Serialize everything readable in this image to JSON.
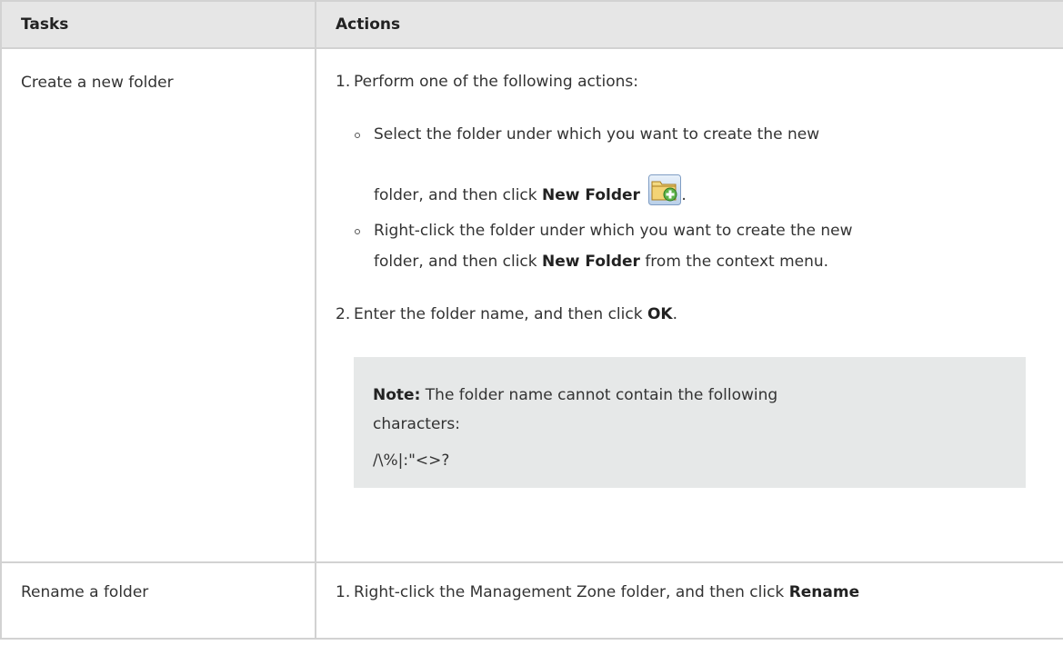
{
  "table": {
    "headers": {
      "tasks": "Tasks",
      "actions": "Actions"
    },
    "rows": [
      {
        "task": "Create a new folder",
        "step1": {
          "number": "1.",
          "text": "Perform one of the following actions:",
          "bullet1": {
            "line1": "Select the folder under which you want to create the new",
            "line2_prefix": "folder, and then click ",
            "line2_bold": "New Folder",
            "line2_suffix": ".",
            "icon": "new-folder-icon"
          },
          "bullet2": {
            "line1": "Right-click the folder under which you want to create the new",
            "line2_prefix": "folder, and then click ",
            "line2_bold": "New Folder",
            "line2_suffix": " from the context menu."
          }
        },
        "step2": {
          "number": "2.",
          "prefix": "Enter the folder name, and then click ",
          "bold": "OK",
          "suffix": "."
        },
        "note": {
          "label": "Note:",
          "line1": " The folder name cannot contain the following",
          "line2": "characters:",
          "chars": "/\\%|:\"<>?"
        }
      },
      {
        "task": "Rename a folder",
        "step1": {
          "number": "1.",
          "prefix": "Right-click the Management Zone folder, and then click ",
          "bold": "Rename"
        }
      }
    ]
  },
  "colors": {
    "header_bg": "#e6e6e6",
    "border": "#d2d2d2",
    "note_bg": "#e6e8e8",
    "text": "#333333"
  }
}
